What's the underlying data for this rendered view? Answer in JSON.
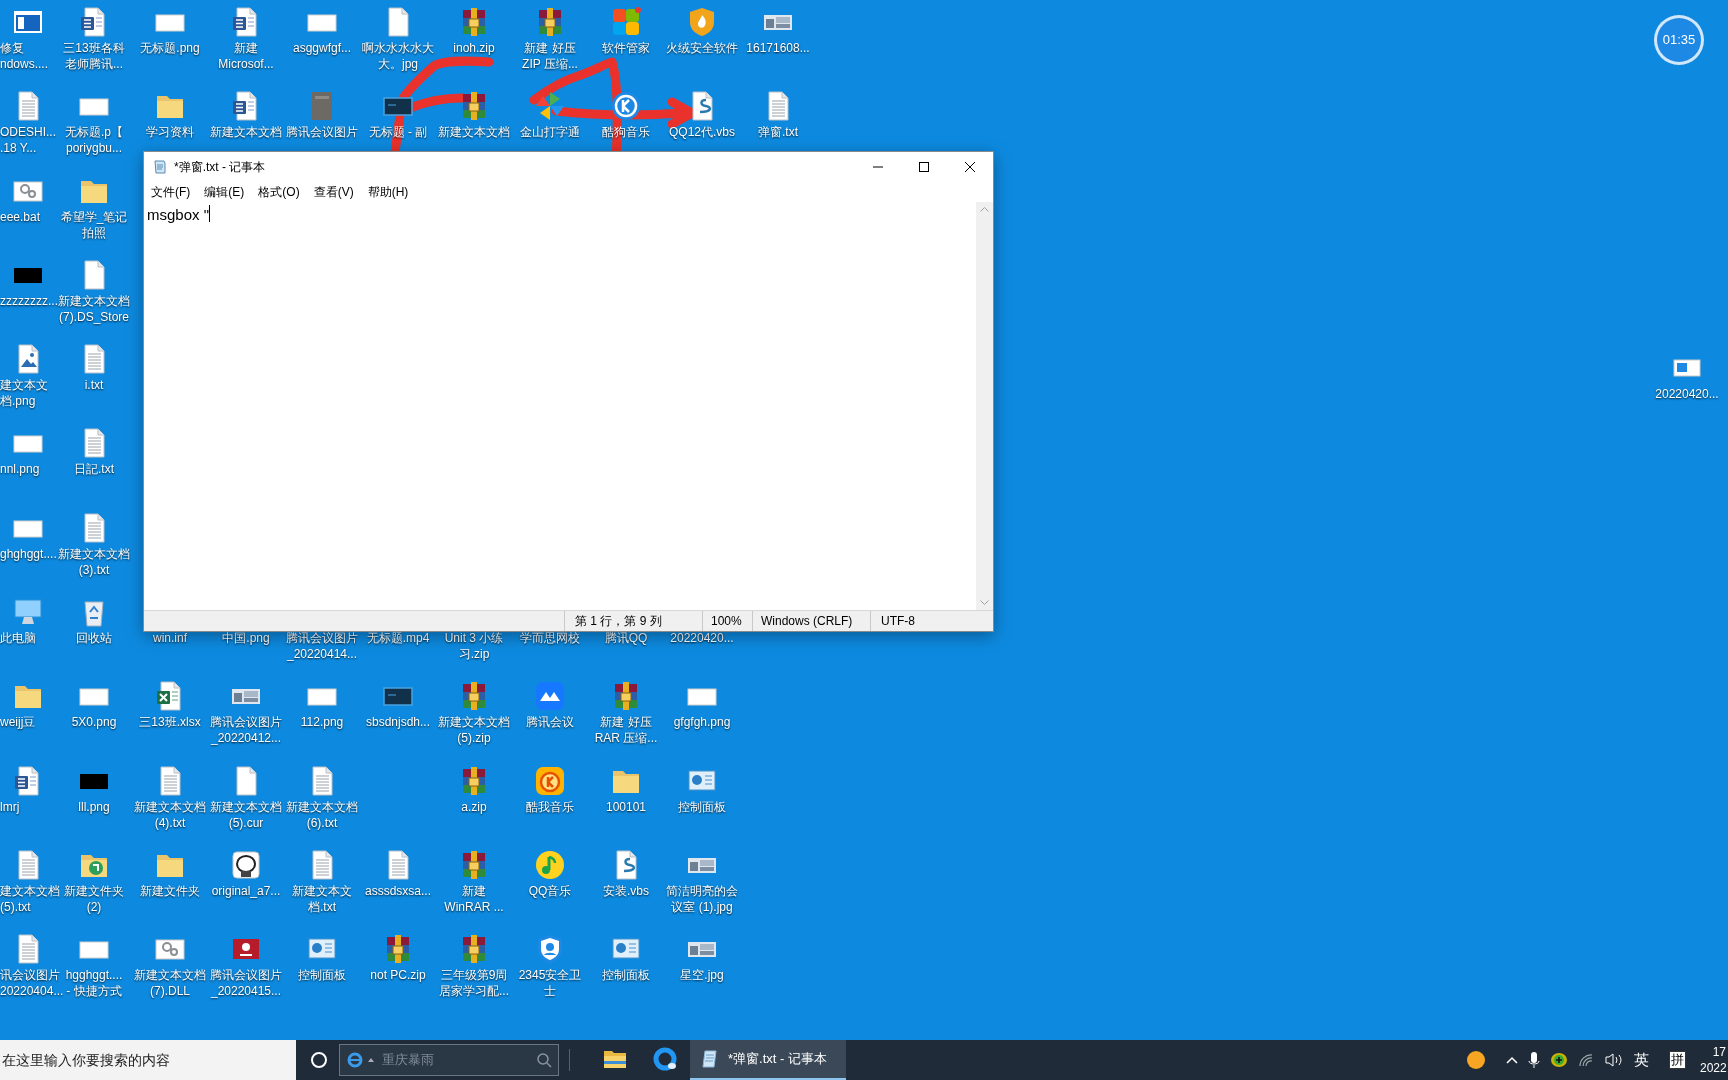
{
  "desktop": {
    "rows": [
      [
        {
          "kind": "appwin",
          "label": [
            "修复",
            "ndows...."
          ]
        },
        {
          "kind": "word",
          "label": [
            "三13班各科",
            "老师腾讯..."
          ]
        },
        {
          "kind": "image",
          "label": [
            "无标题.png"
          ]
        },
        {
          "kind": "word",
          "label": [
            "新建",
            "Microsof..."
          ]
        },
        {
          "kind": "image",
          "label": [
            "asggwfgf..."
          ]
        },
        {
          "kind": "file",
          "label": [
            "啊水水水水大",
            "大。jpg"
          ]
        },
        {
          "kind": "rar",
          "label": [
            "inoh.zip"
          ]
        },
        {
          "kind": "rar",
          "label": [
            "新建 好压",
            "ZIP 压缩..."
          ]
        },
        {
          "kind": "tiles",
          "label": [
            "软件管家"
          ]
        },
        {
          "kind": "shield",
          "label": [
            "火绒安全软件"
          ]
        },
        {
          "kind": "photo",
          "label": [
            "16171608..."
          ]
        }
      ],
      [
        {
          "kind": "txt",
          "label": [
            "ODESHI...",
            ".18  Y..."
          ]
        },
        {
          "kind": "image",
          "label": [
            "无标题.p【",
            "poriygbu..."
          ]
        },
        {
          "kind": "folder",
          "label": [
            "学习资料"
          ]
        },
        {
          "kind": "word",
          "label": [
            "新建文本文档"
          ]
        },
        {
          "kind": "book",
          "label": [
            "腾讯会议图片"
          ]
        },
        {
          "kind": "monitor",
          "label": [
            "无标题 - 副"
          ]
        },
        {
          "kind": "rar",
          "label": [
            "新建文本文档"
          ]
        },
        {
          "kind": "pinwheel",
          "label": [
            "金山打字通"
          ]
        },
        {
          "kind": "kugou",
          "label": [
            "酷狗音乐"
          ]
        },
        {
          "kind": "vbs",
          "label": [
            "QQ12代.vbs"
          ]
        },
        {
          "kind": "txt",
          "label": [
            "弹窗.txt"
          ]
        }
      ],
      [
        {
          "kind": "gear",
          "label": [
            "eee.bat"
          ]
        },
        {
          "kind": "folder",
          "label": [
            "希望学_笔记",
            "拍照"
          ]
        },
        null,
        null,
        null,
        null,
        null,
        null,
        null,
        null,
        null
      ],
      [
        {
          "kind": "black",
          "label": [
            "zzzzzzzz..."
          ]
        },
        {
          "kind": "file",
          "label": [
            "新建文本文档",
            "(7).DS_Store"
          ]
        },
        null,
        null,
        null,
        null,
        null,
        null,
        null,
        null,
        null
      ],
      [
        {
          "kind": "picture",
          "label": [
            "建文本文",
            "档.png"
          ]
        },
        {
          "kind": "txt",
          "label": [
            "i.txt"
          ]
        },
        null,
        null,
        null,
        null,
        null,
        null,
        null,
        null,
        null
      ],
      [
        {
          "kind": "image",
          "label": [
            "nnl.png"
          ]
        },
        {
          "kind": "txt",
          "label": [
            "日記.txt"
          ]
        },
        null,
        null,
        null,
        null,
        null,
        null,
        null,
        null,
        null
      ],
      [
        {
          "kind": "image",
          "label": [
            "ghghggt...."
          ]
        },
        {
          "kind": "txt",
          "label": [
            "新建文本文档",
            "(3).txt"
          ]
        },
        null,
        null,
        null,
        null,
        null,
        null,
        null,
        null,
        null
      ],
      [
        {
          "kind": "pc",
          "label": [
            "此电脑"
          ]
        },
        {
          "kind": "recycle",
          "label": [
            "回收站"
          ]
        },
        {
          "label": [
            "win.inf"
          ]
        },
        {
          "label": [
            "中国.png"
          ]
        },
        {
          "label": [
            "腾讯会议图片",
            "_20220414..."
          ]
        },
        {
          "label": [
            "无标题.mp4"
          ]
        },
        {
          "label": [
            "Unit 3 小练",
            "习.zip"
          ]
        },
        {
          "label": [
            "学而思网校"
          ]
        },
        {
          "label": [
            "腾讯QQ"
          ]
        },
        {
          "label": [
            "20220420..."
          ]
        },
        null
      ],
      [
        {
          "kind": "folder",
          "label": [
            "weijj豆"
          ]
        },
        {
          "kind": "image",
          "label": [
            "5X0.png"
          ]
        },
        {
          "kind": "excel",
          "label": [
            "三13班.xlsx"
          ]
        },
        {
          "kind": "photo",
          "label": [
            "腾讯会议图片",
            "_20220412..."
          ]
        },
        {
          "kind": "image",
          "label": [
            "112.png"
          ]
        },
        {
          "kind": "monitor",
          "label": [
            "sbsdnjsdh..."
          ]
        },
        {
          "kind": "rar",
          "label": [
            "新建文本文档",
            "(5).zip"
          ]
        },
        {
          "kind": "meeting",
          "label": [
            "腾讯会议"
          ]
        },
        {
          "kind": "rar",
          "label": [
            "新建 好压",
            "RAR 压缩..."
          ]
        },
        {
          "kind": "image",
          "label": [
            "gfgfgh.png"
          ]
        },
        null
      ],
      [
        {
          "kind": "word",
          "label": [
            "lmrj"
          ]
        },
        {
          "kind": "black",
          "label": [
            "lll.png"
          ]
        },
        {
          "kind": "txt",
          "label": [
            "新建文本文档",
            "(4).txt"
          ]
        },
        {
          "kind": "file",
          "label": [
            "新建文本文档",
            "(5).cur"
          ]
        },
        {
          "kind": "txt",
          "label": [
            "新建文本文档",
            "(6).txt"
          ]
        },
        null,
        {
          "kind": "rar",
          "label": [
            "a.zip"
          ]
        },
        {
          "kind": "kuwo",
          "label": [
            "酷我音乐"
          ]
        },
        {
          "kind": "folder",
          "label": [
            "100101"
          ]
        },
        {
          "kind": "control",
          "label": [
            "控制面板"
          ]
        },
        null
      ],
      [
        {
          "kind": "txt",
          "label": [
            "建文本文档",
            "(5).txt"
          ]
        },
        {
          "kind": "greenfolder",
          "label": [
            "新建文件夹",
            "(2)"
          ]
        },
        {
          "kind": "folder",
          "label": [
            "新建文件夹"
          ]
        },
        {
          "kind": "sticker",
          "label": [
            "original_a7..."
          ]
        },
        {
          "kind": "txt",
          "label": [
            "新建文本文",
            "档.txt"
          ]
        },
        {
          "kind": "txt",
          "label": [
            "asssdsxsa..."
          ]
        },
        {
          "kind": "rar",
          "label": [
            "新建",
            "WinRAR ..."
          ]
        },
        {
          "kind": "qqmusic",
          "label": [
            "QQ音乐"
          ]
        },
        {
          "kind": "vbs",
          "label": [
            "安装.vbs"
          ]
        },
        {
          "kind": "photo",
          "label": [
            "简洁明亮的会",
            "议室 (1).jpg"
          ]
        },
        null
      ],
      [
        {
          "kind": "txt",
          "label": [
            "讯会议图片",
            "20220404..."
          ]
        },
        {
          "kind": "image",
          "label": [
            "hgghggt....",
            "- 快捷方式"
          ]
        },
        {
          "kind": "gear",
          "label": [
            "新建文本文档",
            "(7).DLL"
          ]
        },
        {
          "kind": "redbook",
          "label": [
            "腾讯会议图片",
            "_20220415..."
          ]
        },
        {
          "kind": "control",
          "label": [
            "控制面板"
          ]
        },
        {
          "kind": "rar",
          "label": [
            "not PC.zip"
          ]
        },
        {
          "kind": "rar",
          "label": [
            "三年级第9周",
            "居家学习配..."
          ]
        },
        {
          "kind": "shieldblue",
          "label": [
            "2345安全卫",
            "士"
          ]
        },
        {
          "kind": "control",
          "label": [
            "控制面板"
          ]
        },
        {
          "kind": "photo",
          "label": [
            "星空.jpg"
          ]
        },
        null
      ]
    ]
  },
  "right_icon": {
    "kind": "screenshot",
    "label": [
      "20220420..."
    ]
  },
  "clock_widget": {
    "time": "01:35"
  },
  "notepad": {
    "title": "*弹窗.txt - 记事本",
    "menu": [
      "文件(F)",
      "编辑(E)",
      "格式(O)",
      "查看(V)",
      "帮助(H)"
    ],
    "content": "msgbox \"",
    "status": [
      "第 1 行，第 9 列",
      "100%",
      "Windows (CRLF)",
      "UTF-8"
    ]
  },
  "taskbar": {
    "search": {
      "placeholder": "在这里输入你要搜索的内容"
    },
    "weather": {
      "placeholder": "重庆暴雨"
    },
    "apps": [
      {
        "kind": "explorer",
        "selected": false
      },
      {
        "kind": "browser",
        "selected": false
      },
      {
        "kind": "notepad",
        "label": "*弹窗.txt - 记事本",
        "selected": true
      }
    ],
    "ime": [
      "英",
      "拼"
    ],
    "clock": [
      "17",
      "2022"
    ]
  }
}
